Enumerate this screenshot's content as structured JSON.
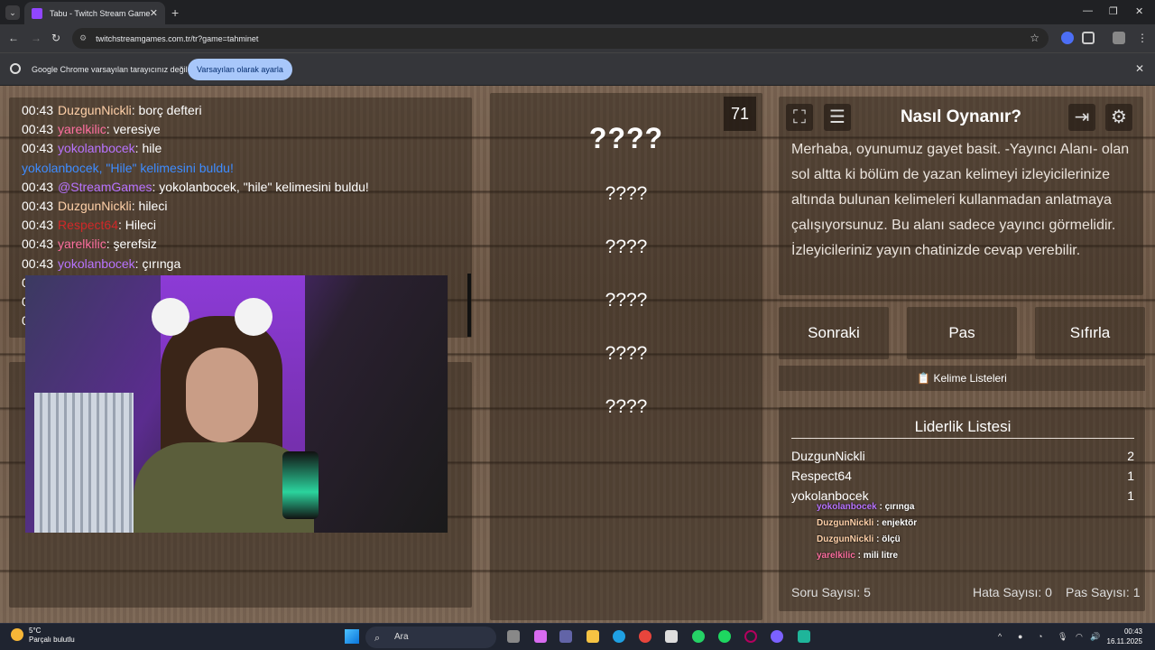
{
  "browser": {
    "tab_title": "Tabu - Twitch Stream Games",
    "url": "twitchstreamgames.com.tr/tr?game=tahminet",
    "infobar_message": "Google Chrome varsayılan tarayıcınız değil",
    "infobar_button": "Varsayılan olarak ayarla"
  },
  "chat": {
    "lines": [
      {
        "time": "00:43",
        "user": "DuzgunNickli",
        "user_color": "#ffd0a8",
        "msg": ": borç defteri"
      },
      {
        "time": "00:43",
        "user": "yarelkilic",
        "user_color": "#ff6fa0",
        "msg": ": veresiye"
      },
      {
        "time": "00:43",
        "user": "yokolanbocek",
        "user_color": "#b873ff",
        "msg": ": hile"
      },
      {
        "time": "",
        "user": "yokolanbocek, \"Hile\" kelimesini buldu!",
        "user_color": "#3e8cff",
        "msg": ""
      },
      {
        "time": "00:43",
        "user": "@StreamGames",
        "user_color": "#b873ff",
        "msg": ": yokolanbocek, \"hile\" kelimesini buldu!"
      },
      {
        "time": "00:43",
        "user": "DuzgunNickli",
        "user_color": "#ffd0a8",
        "msg": ": hileci"
      },
      {
        "time": "00:43",
        "user": "Respect64",
        "user_color": "#d02828",
        "msg": ": Hileci"
      },
      {
        "time": "00:43",
        "user": "yarelkilic",
        "user_color": "#ff6fa0",
        "msg": ": şerefsiz"
      },
      {
        "time": "00:43",
        "user": "yokolanbocek",
        "user_color": "#b873ff",
        "msg": ": çırınga"
      },
      {
        "time": "00:43",
        "user": "DuzgunNickli",
        "user_color": "#ffd0a8",
        "msg": ": enjektör"
      },
      {
        "time": "00:43",
        "user": "DuzgunNickli",
        "user_color": "#ffd0a8",
        "msg": ": ölçü"
      },
      {
        "time": "00:43",
        "user": "yarelkilic",
        "user_color": "#ff6fa0",
        "msg": ": mili litre"
      }
    ]
  },
  "words": {
    "main": "????",
    "taboo": [
      "????",
      "????",
      "????",
      "????",
      "????"
    ],
    "counter": "71"
  },
  "howto": {
    "title": "Nasıl Oynanır?",
    "text": "Merhaba, oyunumuz gayet basit. -Yayıncı Alanı- olan sol altta ki bölüm de yazan kelimeyi izleyicilerinize altında bulunan kelimeleri kullanmadan anlatmaya çalışıyorsunuz. Bu alanı sadece yayıncı görmelidir. İzleyicileriniz yayın chatinizde cevap verebilir."
  },
  "controls": {
    "next": "Sonraki",
    "pass": "Pas",
    "reset": "Sıfırla",
    "word_lists": "Kelime Listeleri"
  },
  "leaderboard": {
    "title": "Liderlik Listesi",
    "rows": [
      {
        "name": "DuzgunNickli",
        "score": "2"
      },
      {
        "name": "Respect64",
        "score": "1"
      },
      {
        "name": "yokolanbocek",
        "score": "1"
      }
    ]
  },
  "stats": {
    "question": "Soru Sayısı: 5",
    "errors": "Hata Sayısı: 0",
    "passes": "Pas Sayısı: 1"
  },
  "overlay": [
    {
      "user": "yokolanbocek",
      "color": "#b873ff",
      "msg": " : çırınga"
    },
    {
      "user": "DuzgunNickli",
      "color": "#ffd0a8",
      "msg": " : enjektör"
    },
    {
      "user": "DuzgunNickli",
      "color": "#ffd0a8",
      "msg": " : ölçü"
    },
    {
      "user": "yarelkilic",
      "color": "#ff6fa0",
      "msg": " : mili litre"
    }
  ],
  "taskbar": {
    "temp": "5°C",
    "weather": "Parçalı bulutlu",
    "search": "Ara",
    "time": "00:43",
    "date": "16.11.2025"
  }
}
